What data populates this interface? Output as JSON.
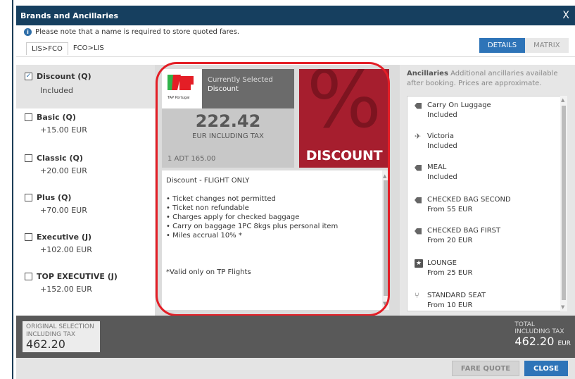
{
  "dialog": {
    "title": "Brands and Ancillaries",
    "close_symbol": "X"
  },
  "notice": {
    "icon": "info-icon",
    "text": "Please note that a name is required to store quoted fares."
  },
  "route_tabs": [
    "LIS>FCO",
    "FCO>LIS"
  ],
  "view_tabs": [
    {
      "label": "DETAILS",
      "active": true
    },
    {
      "label": "MATRIX",
      "active": false
    }
  ],
  "fares": [
    {
      "name": "Discount (Q)",
      "price": "Included",
      "checked": true
    },
    {
      "name": "Basic (Q)",
      "price": "+15.00  EUR",
      "checked": false
    },
    {
      "name": "Classic (Q)",
      "price": "+20.00  EUR",
      "checked": false
    },
    {
      "name": "Plus (Q)",
      "price": "+70.00  EUR",
      "checked": false
    },
    {
      "name": "Executive (J)",
      "price": "+102.00  EUR",
      "checked": false
    },
    {
      "name": "TOP EXECUTIVE (J)",
      "price": "+152.00  EUR",
      "checked": false
    }
  ],
  "summary": {
    "airline_logo_text": "TAP Portugal",
    "currently_selected_label": "Currently Selected",
    "selected_brand": "Discount",
    "amount": "222.42",
    "amount_label": "EUR INCLUDING TAX",
    "passenger_line": "1 ADT 165.00"
  },
  "brand_image": {
    "symbol": "%",
    "label": "DISCOUNT",
    "color": "#a61e2e"
  },
  "description": {
    "heading": "Discount - FLIGHT ONLY",
    "bullets": [
      "• Ticket changes not permitted",
      "• Ticket non refundable",
      "• Charges apply for checked baggage",
      "• Carry on baggage 1PC 8kgs plus personal item",
      "• Miles accrual 10% *"
    ],
    "footnote": "*Valid only on TP Flights"
  },
  "ancillaries": {
    "title": "Ancillaries",
    "subtitle": "Additional ancillaries available after booking. Prices are approximate.",
    "items": [
      {
        "icon": "tag-icon",
        "name": "Carry On Luggage",
        "detail": "Included"
      },
      {
        "icon": "plane-icon",
        "name": "Victoria",
        "detail": "Included"
      },
      {
        "icon": "tag-icon",
        "name": "MEAL",
        "detail": "Included"
      },
      {
        "icon": "tag-icon",
        "name": "CHECKED BAG SECOND",
        "detail": "From 55 EUR"
      },
      {
        "icon": "tag-icon",
        "name": "CHECKED BAG FIRST",
        "detail": "From 20 EUR"
      },
      {
        "icon": "star-icon",
        "name": "LOUNGE",
        "detail": "From 25 EUR"
      },
      {
        "icon": "seat-icon",
        "name": "STANDARD SEAT",
        "detail": "From 10 EUR"
      }
    ]
  },
  "totals": {
    "original_label_1": "ORIGINAL SELECTION",
    "original_label_2": "INCLUDING TAX",
    "original_value": "462.20",
    "total_label_1": "TOTAL",
    "total_label_2": "INCLUDING TAX",
    "total_value": "462.20",
    "total_currency": "EUR"
  },
  "buttons": {
    "fare_quote": "FARE QUOTE",
    "close": "CLOSE"
  },
  "colors": {
    "titlebar": "#163f5f",
    "accent": "#2e74b8",
    "highlight_ring": "#e41e26"
  }
}
